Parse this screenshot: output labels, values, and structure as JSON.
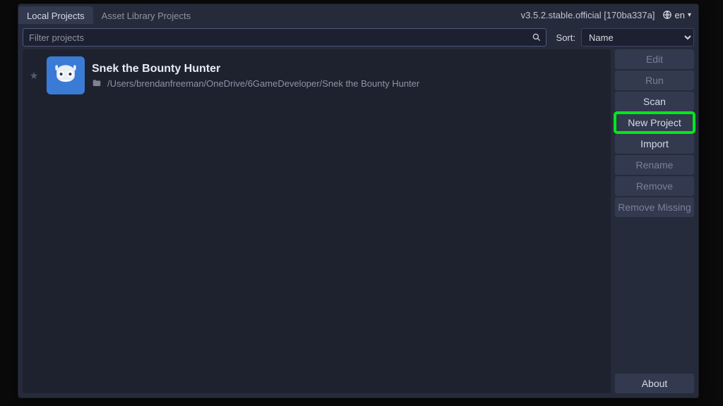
{
  "topbar": {
    "tabs": [
      {
        "label": "Local Projects",
        "active": true
      },
      {
        "label": "Asset Library Projects",
        "active": false
      }
    ],
    "version": "v3.5.2.stable.official [170ba337a]",
    "language": "en"
  },
  "filter": {
    "placeholder": "Filter projects",
    "sort_label": "Sort:",
    "sort_value": "Name"
  },
  "projects": [
    {
      "title": "Snek the Bounty Hunter",
      "path": "/Users/brendanfreeman/OneDrive/6GameDeveloper/Snek the Bounty Hunter",
      "favorite": false
    }
  ],
  "sidebar": {
    "edit": "Edit",
    "run": "Run",
    "scan": "Scan",
    "new_project": "New Project",
    "import": "Import",
    "rename": "Rename",
    "remove": "Remove",
    "remove_missing": "Remove Missing",
    "about": "About"
  },
  "colors": {
    "highlight_stroke": "#00e81a"
  }
}
